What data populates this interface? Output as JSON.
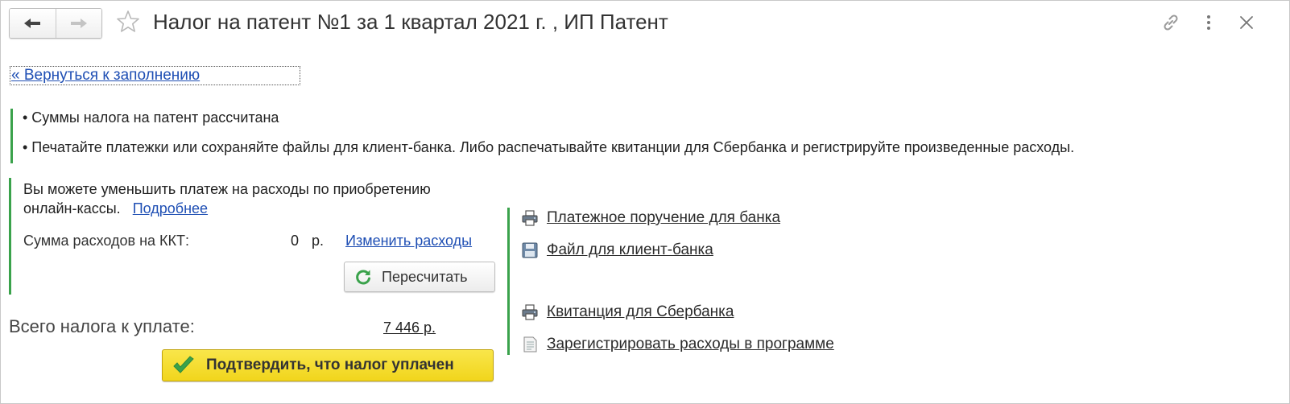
{
  "header": {
    "title": "Налог на патент №1 за 1 квартал 2021 г. , ИП Патент",
    "icons": {
      "back": "arrow-left-icon",
      "forward": "arrow-right-icon",
      "favorite": "star-icon",
      "link": "link-icon",
      "more": "more-vertical-icon",
      "close": "close-icon"
    }
  },
  "back_link": "« Вернуться к заполнению",
  "info": {
    "lines": [
      "• Суммы налога на патент рассчитана",
      "• Печатайте платежки или сохраняйте файлы для клиент-банка. Либо распечатывайте квитанции для Сбербанка и регистрируйте произведенные расходы."
    ]
  },
  "kkt": {
    "text_line1": "Вы можете уменьшить платеж на расходы по приобретению",
    "text_line2": "онлайн-кассы.",
    "more_link": "Подробнее",
    "sum_label": "Сумма расходов на ККТ:",
    "sum_value": "0",
    "sum_unit": "р.",
    "change_link": "Изменить расходы",
    "recalc_label": "Пересчитать"
  },
  "total": {
    "label": "Всего налога к уплате:",
    "value": "7 446 р."
  },
  "confirm_label": "Подтвердить, что налог уплачен",
  "actions": [
    {
      "label": "Платежное поручение для банка",
      "icon": "printer-icon"
    },
    {
      "label": "Файл для клиент-банка",
      "icon": "floppy-disk-icon"
    },
    {
      "label": "Квитанция для Сбербанка",
      "icon": "printer-icon"
    },
    {
      "label": "Зарегистрировать расходы в программе",
      "icon": "document-icon"
    }
  ],
  "colors": {
    "accent_green": "#3aa24b",
    "link_blue": "#1f4fb4",
    "confirm_yellow": "#f4da26"
  }
}
